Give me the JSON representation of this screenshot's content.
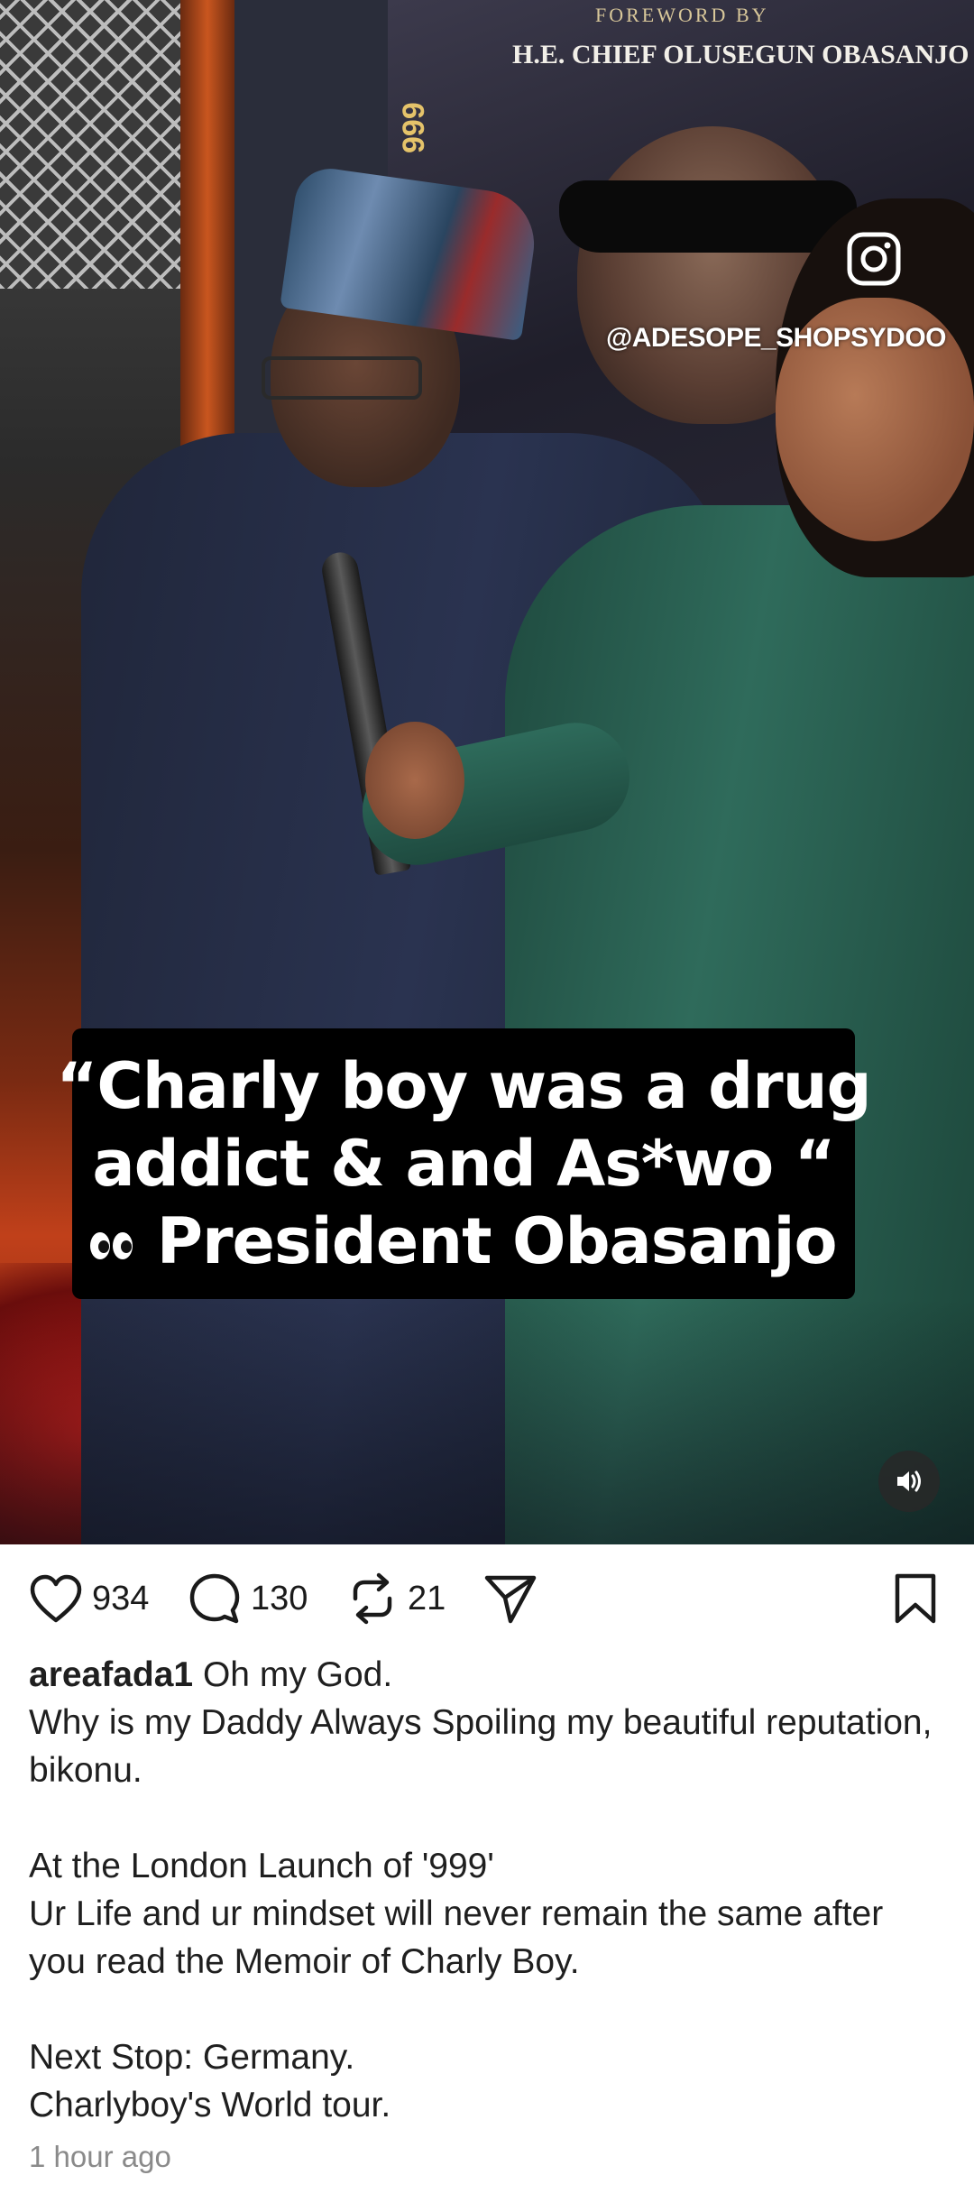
{
  "media": {
    "poster_foreword": "FOREWORD BY",
    "poster_name": "H.E. CHIEF OLUSEGUN OBASANJO",
    "poster_number": "999",
    "watermark": "@ADESOPE_SHOPSYDOO",
    "caption_lines": [
      "“Charly boy was a drug",
      "addict & and As*wo “",
      "President Obasanjo"
    ],
    "sound_icon": "speaker-icon",
    "instagram_icon": "instagram-icon"
  },
  "actions": {
    "likes": "934",
    "comments": "130",
    "reposts": "21"
  },
  "post": {
    "username": "areafada1",
    "first_line": " Oh my God.",
    "lines": [
      "Why is my Daddy Always Spoiling my beautiful reputation, bikonu.",
      "",
      "At the London Launch of '999'",
      "Ur Life and ur mindset will never remain the same after you read the Memoir of Charly Boy.",
      "",
      "Next Stop: Germany.",
      "Charlyboy's World tour."
    ],
    "timestamp": "1 hour ago"
  }
}
